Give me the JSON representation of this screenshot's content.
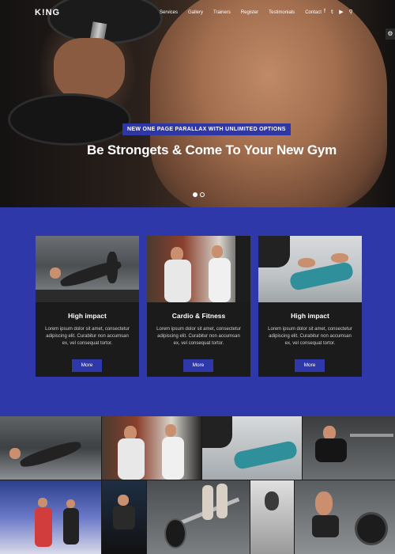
{
  "nav": {
    "logo": "K!NG",
    "menu": [
      "Services",
      "Gallery",
      "Trainers",
      "Register",
      "Testimonials",
      "Contact"
    ],
    "social_icons": [
      "facebook-icon",
      "twitter-icon",
      "youtube-icon",
      "search-icon"
    ]
  },
  "hero": {
    "tagline": "NEW ONE PAGE PARALLAX WITH UNLIMITED OPTIONS",
    "headline": "Be Strongets & Come To Your New Gym",
    "slides": 2,
    "active_slide": 1
  },
  "features": [
    {
      "title": "High impact",
      "desc": "Lorem ipsum dolor sit amet, consectetur adipiscing elit. Curabitur non accumsan ex, vel consequat tortor.",
      "button": "More"
    },
    {
      "title": "Cardio & Fitness",
      "desc": "Lorem ipsum dolor sit amet, consectetur adipiscing elit. Curabitur non accumsan ex, vel consequat tortor.",
      "button": "More"
    },
    {
      "title": "High impact",
      "desc": "Lorem ipsum dolor sit amet, consectetur adipiscing elit. Curabitur non accumsan ex, vel consequat tortor.",
      "button": "More"
    }
  ],
  "colors": {
    "accent": "#2f38a8",
    "card_bg": "#1b1b1b",
    "text_light": "#ffffff"
  }
}
